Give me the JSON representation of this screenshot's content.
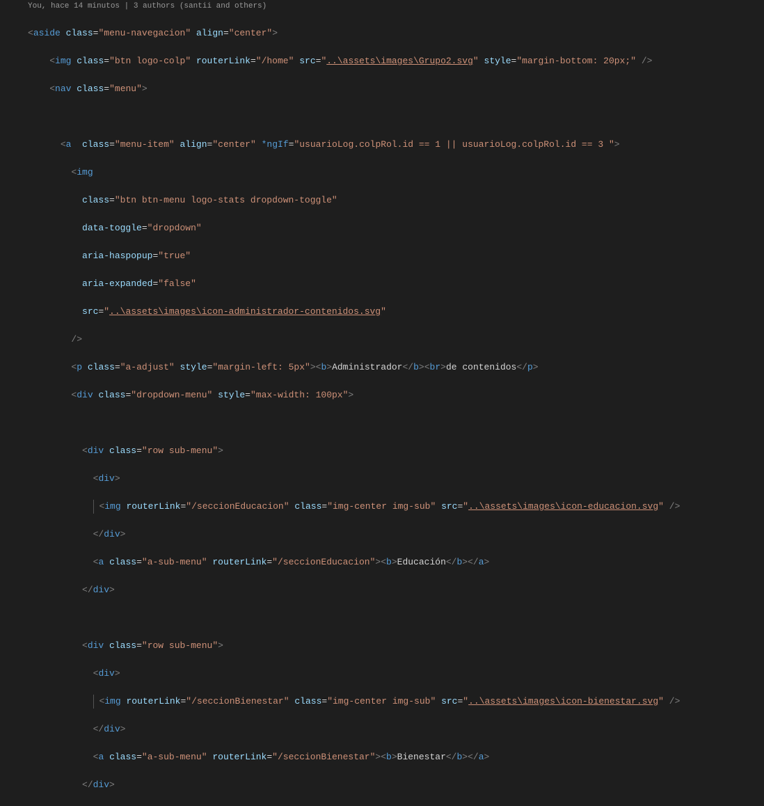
{
  "codelens": "You, hace 14 minutos | 3 authors (santii and others)",
  "code": {
    "l1": {
      "open": "<",
      "tag": "aside",
      "a1": "class",
      "v1": "menu-navegacion",
      "a2": "align",
      "v2": "center",
      "close": ">"
    },
    "l2": {
      "open": "<",
      "tag": "img",
      "a1": "class",
      "v1": "btn logo-colp",
      "a2": "routerLink",
      "v2": "/home",
      "a3": "src",
      "v3": "..\\assets\\images\\Grupo2.svg",
      "a4": "style",
      "v4": "margin-bottom: 20px;",
      "close": "/>"
    },
    "l3": {
      "open": "<",
      "tag": "nav",
      "a1": "class",
      "v1": "menu",
      "close": ">"
    },
    "l5": {
      "open": "<",
      "tag": "a",
      "a1": "class",
      "v1": "menu-item",
      "a2": "align",
      "v2": "center",
      "a3": "*ngIf",
      "v3": "usuarioLog.colpRol.id == 1 || usuarioLog.colpRol.id == 3 ",
      "close": ">"
    },
    "l6": {
      "open": "<",
      "tag": "img"
    },
    "l7": {
      "a": "class",
      "v": "btn btn-menu logo-stats dropdown-toggle"
    },
    "l8": {
      "a": "data-toggle",
      "v": "dropdown"
    },
    "l9": {
      "a": "aria-haspopup",
      "v": "true"
    },
    "l10": {
      "a": "aria-expanded",
      "v": "false"
    },
    "l11": {
      "a": "src",
      "v": "..\\assets\\images\\icon-administrador-contenidos.svg"
    },
    "l12": {
      "close": "/>"
    },
    "l13": {
      "open": "<",
      "tag": "p",
      "a1": "class",
      "v1": "a-adjust",
      "a2": "style",
      "v2": "margin-left: 5px",
      "btag": "b",
      "txt1": "Administrador",
      "brtag": "br",
      "txt2": "de contenidos"
    },
    "l14": {
      "open": "<",
      "tag": "div",
      "a1": "class",
      "v1": "dropdown-menu",
      "a2": "style",
      "v2": "max-width: 100px",
      "close": ">"
    },
    "l16": {
      "open": "<",
      "tag": "div",
      "a1": "class",
      "v1": "row sub-menu",
      "close": ">"
    },
    "l17": {
      "open": "<",
      "tag": "div",
      "close": ">"
    },
    "l18": {
      "open": "<",
      "tag": "img",
      "a1": "routerLink",
      "v1": "/seccionEducacion",
      "a2": "class",
      "v2": "img-center img-sub",
      "a3": "src",
      "v3": "..\\assets\\images\\icon-educacion.svg",
      "close": "/>"
    },
    "l19": {
      "open": "</",
      "tag": "div",
      "close": ">"
    },
    "l20": {
      "open": "<",
      "tag": "a",
      "a1": "class",
      "v1": "a-sub-menu",
      "a2": "routerLink",
      "v2": "/seccionEducacion",
      "btag": "b",
      "txt": "Educación"
    },
    "l21": {
      "open": "</",
      "tag": "div",
      "close": ">"
    },
    "l23": {
      "open": "<",
      "tag": "div",
      "a1": "class",
      "v1": "row sub-menu",
      "close": ">"
    },
    "l24": {
      "open": "<",
      "tag": "div",
      "close": ">"
    },
    "l25": {
      "open": "<",
      "tag": "img",
      "a1": "routerLink",
      "v1": "/seccionBienestar",
      "a2": "class",
      "v2": "img-center img-sub",
      "a3": "src",
      "v3": "..\\assets\\images\\icon-bienestar.svg",
      "close": "/>"
    },
    "l26": {
      "open": "</",
      "tag": "div",
      "close": ">"
    },
    "l27": {
      "open": "<",
      "tag": "a",
      "a1": "class",
      "v1": "a-sub-menu",
      "a2": "routerLink",
      "v2": "/seccionBienestar",
      "btag": "b",
      "txt": "Bienestar"
    },
    "l28": {
      "open": "</",
      "tag": "div",
      "close": ">"
    }
  }
}
